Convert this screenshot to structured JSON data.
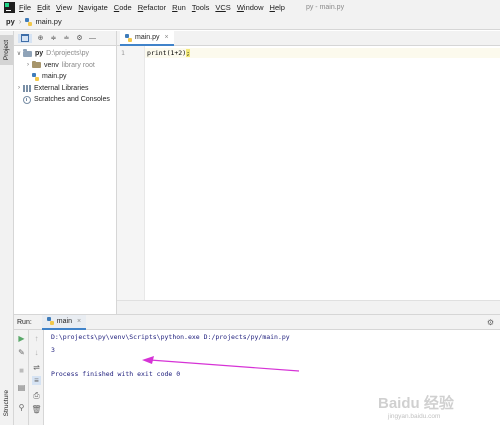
{
  "menubar": {
    "items": [
      {
        "key": "F",
        "rest": "ile"
      },
      {
        "key": "E",
        "rest": "dit"
      },
      {
        "key": "V",
        "rest": "iew"
      },
      {
        "key": "N",
        "rest": "avigate"
      },
      {
        "key": "C",
        "rest": "ode"
      },
      {
        "key": "R",
        "rest": "efactor"
      },
      {
        "key": "R",
        "rest": "un"
      },
      {
        "key": "T",
        "rest": "ools"
      },
      {
        "key": "VC",
        "rest": "S"
      },
      {
        "key": "W",
        "rest": "indow"
      },
      {
        "key": "H",
        "rest": "elp"
      }
    ],
    "window_title": "py - main.py"
  },
  "breadcrumb": {
    "root": "py",
    "file": "main.py"
  },
  "left_strip": {
    "project_tab": "Project",
    "structure_tab": "Structure"
  },
  "project_panel": {
    "tree": {
      "root_name": "py",
      "root_path": "D:\\projects\\py",
      "venv_name": "venv",
      "venv_note": "library root",
      "file_name": "main.py",
      "external_libraries": "External Libraries",
      "scratches": "Scratches and Consoles"
    }
  },
  "editor": {
    "tab_label": "main.py",
    "line_number": "1",
    "code_line": "print(1+2)",
    "code_tail": ";"
  },
  "run_panel": {
    "label": "Run:",
    "tab_label": "main",
    "console": [
      "D:\\projects\\py\\venv\\Scripts\\python.exe D:/projects/py/main.py",
      "3",
      "",
      "Process finished with exit code 0"
    ]
  },
  "watermark": {
    "main": "Baidu 经验",
    "sub": "jingyan.baidu.com"
  },
  "colors": {
    "accent": "#4083c9",
    "arrow": "#d633d6",
    "console_text": "#1a1a7a",
    "run_green": "#59a869"
  }
}
